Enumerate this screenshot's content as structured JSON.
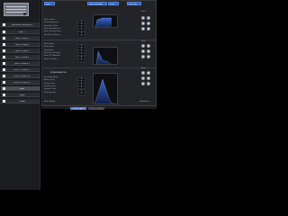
{
  "sidebar": {
    "items": [
      {
        "label": "Synthesizer Parameters",
        "selected": false
      },
      {
        "label": "Main 1",
        "selected": false
      },
      {
        "label": "Mod 1 & Mod 2",
        "selected": false
      },
      {
        "label": "Mod 3 & Mod 4",
        "selected": false
      },
      {
        "label": "Mod 5 & Mod 6",
        "selected": false
      },
      {
        "label": "Mod 7 & Mod 8",
        "selected": false
      },
      {
        "label": "Mod 9 & Mod 10",
        "selected": false
      },
      {
        "label": "Mod 11 & Mod 12",
        "selected": false
      },
      {
        "label": "Mod 13 & Mod 14",
        "selected": false
      },
      {
        "label": "Mod 15 & Mod 16",
        "selected": false
      },
      {
        "label": "Filter",
        "selected": true
      },
      {
        "label": "Global",
        "selected": false
      },
      {
        "label": "Output",
        "selected": false
      }
    ]
  },
  "panel": {
    "tabs": [
      {
        "label": "Main"
      },
      {
        "label": "Filter Envelope"
      },
      {
        "label": "Filter"
      },
      {
        "label": "Filter Env"
      }
    ],
    "section1": {
      "params": [
        {
          "label": "Filter Cutoff",
          "value": "0"
        },
        {
          "label": "Filter Resonance",
          "value": "0"
        },
        {
          "label": "Filter Key Track",
          "value": "0"
        },
        {
          "label": "Filter Env Amount",
          "value": "0"
        },
        {
          "label": "Filter Velocity Sens",
          "value": "0"
        },
        {
          "label": "Filter Env Velocity",
          "value": "0"
        }
      ]
    },
    "section2": {
      "params": [
        {
          "label": "Filter Mode",
          "value": "0"
        },
        {
          "label": "Filter Drive",
          "value": "0"
        },
        {
          "label": "Saturation",
          "value": "0"
        },
        {
          "label": "Filter Env Velocity",
          "value": "0"
        },
        {
          "label": "Filter LFO Amount",
          "value": "0"
        },
        {
          "label": "Filter LFO Rate",
          "value": "0"
        }
      ]
    },
    "section3": {
      "header": "FILTER ENVELOPE",
      "params": [
        {
          "label": "Envelope Mode",
          "value": "0"
        },
        {
          "label": "Attack Time",
          "value": "0"
        },
        {
          "label": "Decay Time",
          "value": "0"
        },
        {
          "label": "Sustain Level",
          "value": "0"
        },
        {
          "label": "Release Time",
          "value": "0"
        },
        {
          "label": "Velocity Sens",
          "value": "0"
        }
      ]
    },
    "right_labels": [
      "Pitch",
      "Filter",
      "Amp"
    ],
    "bottom": {
      "left_label": "Mono Range",
      "buttons": [
        {
          "label": "Mono Legato"
        },
        {
          "label": "Mono Retrigger"
        }
      ],
      "right_label": "Modulation"
    }
  },
  "colors": {
    "accent": "#2f5fb8",
    "graph_fill_top": "#3e63c9",
    "graph_fill_bottom": "#0c1b3a"
  }
}
